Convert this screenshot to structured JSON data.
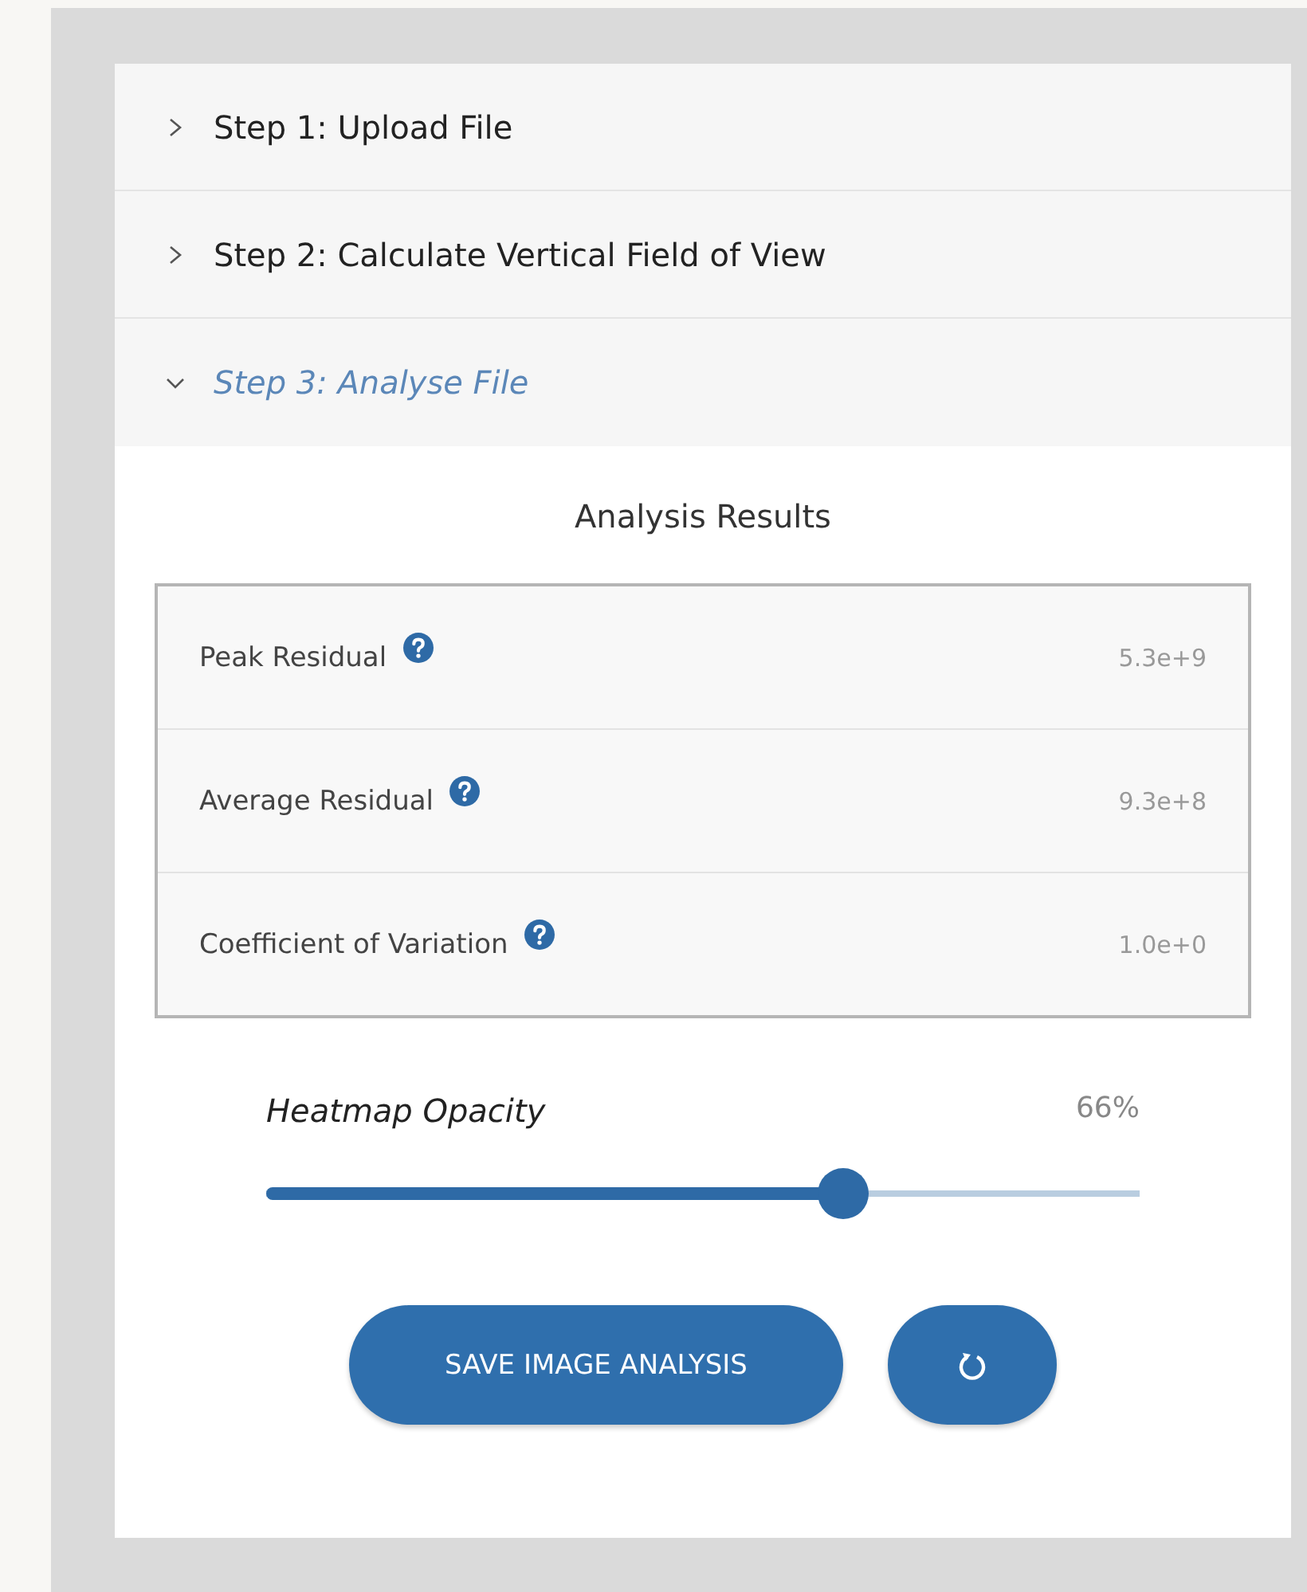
{
  "steps": [
    {
      "label": "Step 1: Upload File",
      "expanded": false
    },
    {
      "label": "Step 2: Calculate Vertical Field of View",
      "expanded": false
    },
    {
      "label": "Step 3: Analyse File",
      "expanded": true
    }
  ],
  "results": {
    "title": "Analysis Results",
    "rows": [
      {
        "label": "Peak Residual",
        "value": "5.3e+9"
      },
      {
        "label": "Average Residual",
        "value": "9.3e+8"
      },
      {
        "label": "Coefficient of Variation",
        "value": "1.0e+0"
      }
    ]
  },
  "opacity": {
    "label": "Heatmap Opacity",
    "reading": "66%",
    "level": 0.66
  },
  "buttons": {
    "save": "SAVE IMAGE ANALYSIS"
  }
}
